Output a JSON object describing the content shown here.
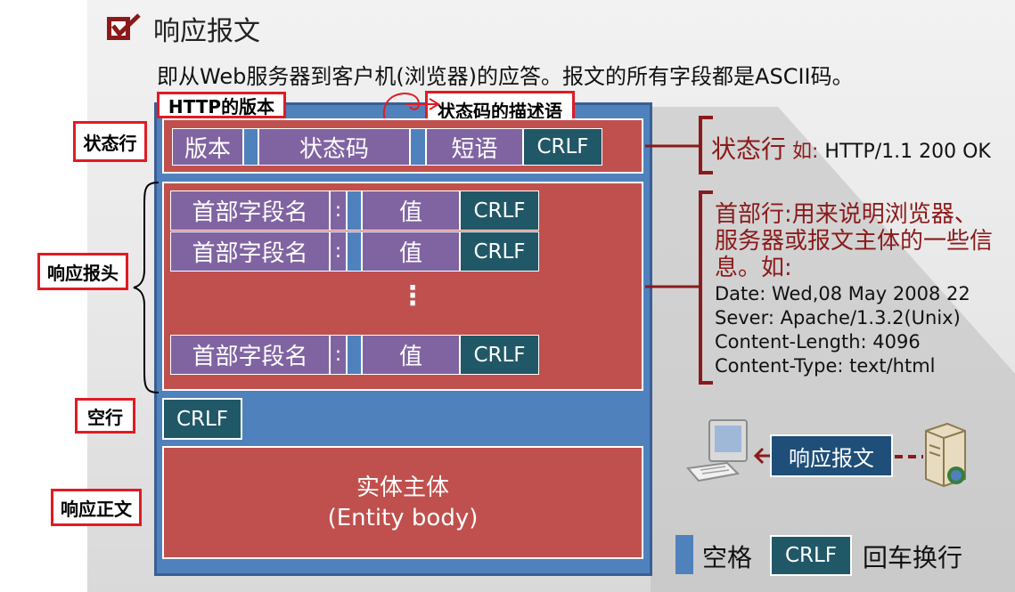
{
  "title": "响应报文",
  "subtitle": "即从Web服务器到客户机(浏览器)的应答。报文的所有字段都是ASCII码。",
  "left_labels": {
    "status_line": "状态行",
    "response_header": "响应报头",
    "blank_line": "空行",
    "response_body": "响应正文"
  },
  "top_labels": {
    "http_version": "HTTP的版本",
    "status_desc": "状态码的描述语"
  },
  "status_line": {
    "version": "版本",
    "code": "状态码",
    "phrase": "短语",
    "crlf": "CRLF"
  },
  "header_rows": [
    {
      "name": "首部字段名",
      "colon": ":",
      "value": "值",
      "crlf": "CRLF"
    },
    {
      "name": "首部字段名",
      "colon": ":",
      "value": "值",
      "crlf": "CRLF"
    },
    {
      "name": "首部字段名",
      "colon": ":",
      "value": "值",
      "crlf": "CRLF"
    }
  ],
  "ellipsis": "⋮",
  "blank_crlf": "CRLF",
  "entity_body": {
    "line1": "实体主体",
    "line2": "(Entity body)"
  },
  "right_status": {
    "label": "状态行",
    "eg": " 如: ",
    "example": "HTTP/1.1 200 OK"
  },
  "right_header": {
    "desc": "首部行:用来说明浏览器、服务器或报文主体的一些信息。如:",
    "lines": [
      "Date:  Wed,08  May 2008 22",
      "Sever:  Apache/1.3.2(Unix)",
      "Content-Length:  4096",
      "Content-Type:  text/html"
    ]
  },
  "response_message_tag": "响应报文",
  "legend": {
    "space_label": "空格",
    "crlf_box": "CRLF",
    "crlf_label": "回车换行"
  },
  "colors": {
    "red_box": "#c0504d",
    "purple": "#8064a2",
    "blue": "#4f81bd",
    "dark_teal": "#215868",
    "dark_red": "#8b1a1a",
    "highlight": "#e01b24"
  }
}
